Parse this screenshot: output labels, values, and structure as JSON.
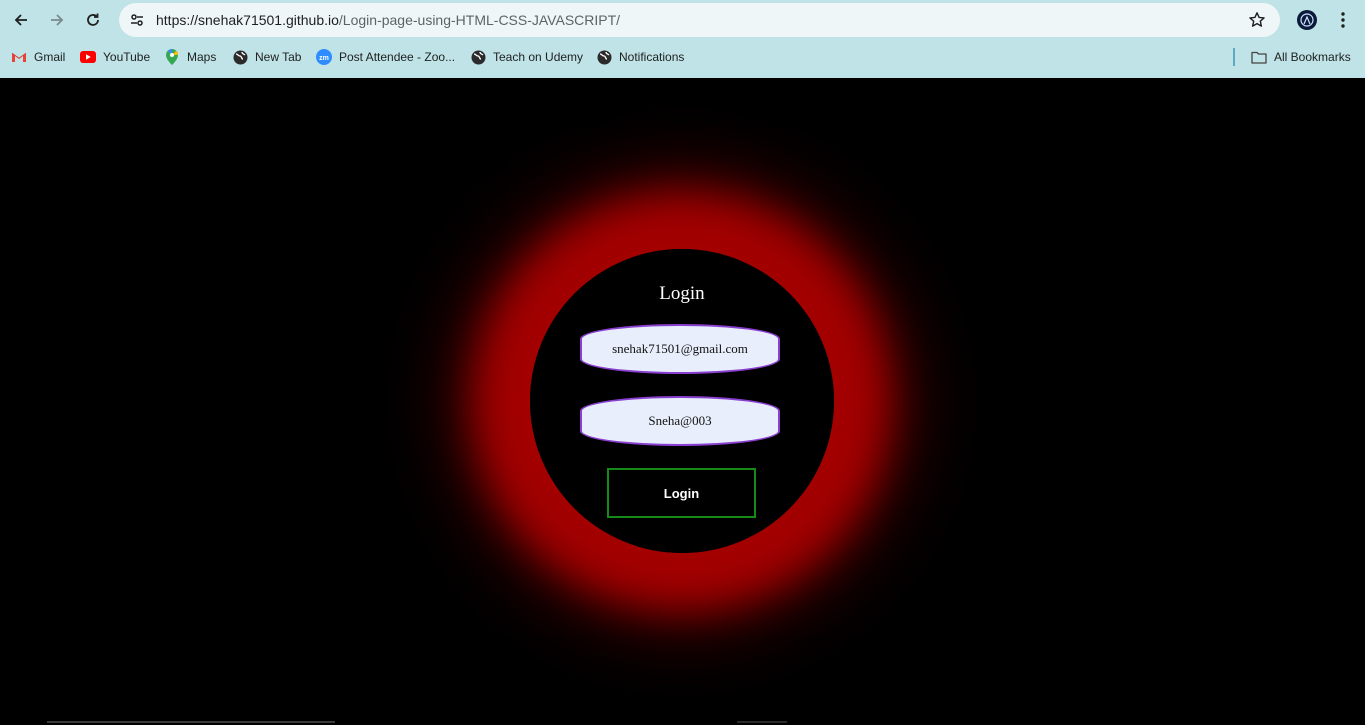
{
  "browser": {
    "url_host": "https://snehak71501.github.io",
    "url_path": "/Login-page-using-HTML-CSS-JAVASCRIPT/",
    "bookmarks": [
      {
        "label": "Gmail",
        "icon": "gmail-icon"
      },
      {
        "label": "YouTube",
        "icon": "youtube-icon"
      },
      {
        "label": "Maps",
        "icon": "maps-icon"
      },
      {
        "label": "New Tab",
        "icon": "globe-icon"
      },
      {
        "label": "Post Attendee - Zoo...",
        "icon": "zoom-icon"
      },
      {
        "label": "Teach on Udemy",
        "icon": "globe-icon"
      },
      {
        "label": "Notifications",
        "icon": "globe-icon"
      }
    ],
    "all_bookmarks_label": "All Bookmarks",
    "colors": {
      "chrome_bg": "#bfe3e6",
      "omnibox_bg": "#eef6f8"
    }
  },
  "login": {
    "title": "Login",
    "email_value": "snehak71501@gmail.com",
    "password_value": "Sneha@003",
    "button_label": "Login",
    "colors": {
      "glow": "#a30000",
      "field_border": "#8a3fd0",
      "button_border": "#168a16",
      "page_bg": "#000000"
    }
  }
}
